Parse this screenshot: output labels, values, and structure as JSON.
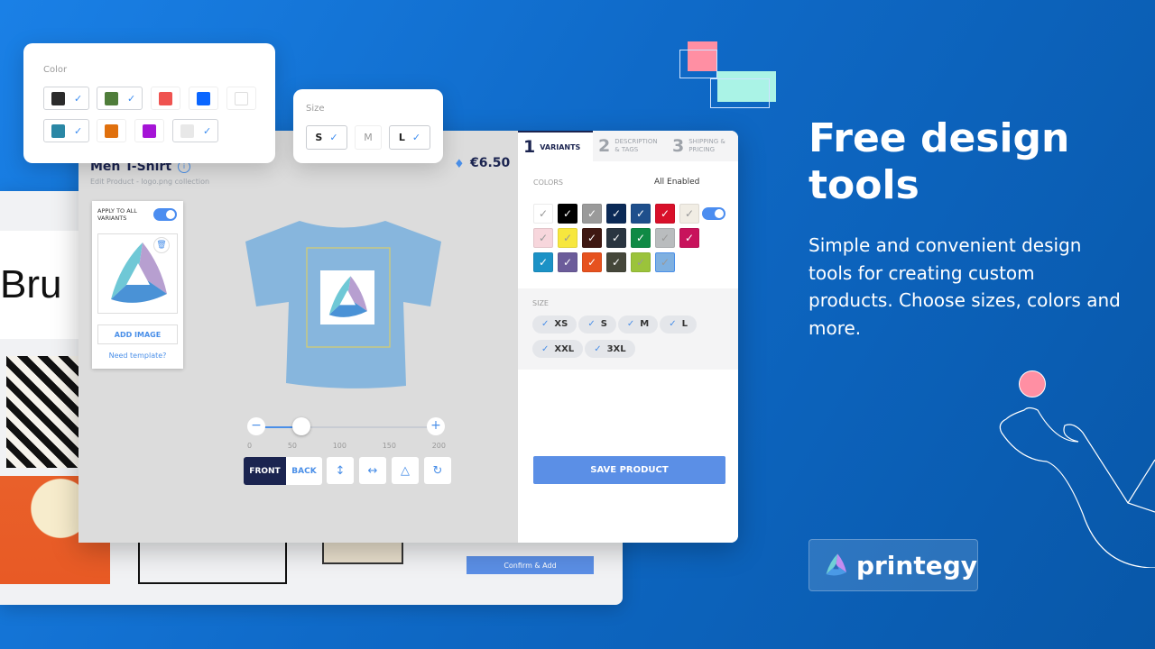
{
  "hero": {
    "title": "Free design tools",
    "description": "Simple and convenient design tools for creating custom products. Choose sizes, colors and more.",
    "brand": "printegy"
  },
  "background_panel": {
    "preview_text": "Bru",
    "confirm_label": "Confirm & Add"
  },
  "color_popup": {
    "label": "Color",
    "options": [
      {
        "color": "#2b2b2b",
        "checked": true
      },
      {
        "color": "#4f7d3a",
        "checked": true
      },
      {
        "color": "#ef5350",
        "checked": false
      },
      {
        "color": "#0a66ff",
        "checked": false
      },
      {
        "color": "#ffffff",
        "checked": false
      },
      {
        "color": "#2a87a5",
        "checked": true
      },
      {
        "color": "#e0700d",
        "checked": false
      },
      {
        "color": "#a514d6",
        "checked": false
      },
      {
        "color": "#e8e8e8",
        "checked": true
      }
    ]
  },
  "size_popup": {
    "label": "Size",
    "options": [
      {
        "label": "S",
        "checked": true
      },
      {
        "label": "M",
        "checked": false
      },
      {
        "label": "L",
        "checked": true
      }
    ]
  },
  "product": {
    "title": "Men T-Shirt",
    "subtitle": "Edit Product - logo.png collection",
    "price": "€6.50"
  },
  "image_panel": {
    "apply_label": "APPLY TO ALL VARIANTS",
    "apply_enabled": true,
    "add_image": "ADD IMAGE",
    "need_template": "Need template?"
  },
  "scale_slider": {
    "value": 50,
    "min": 0,
    "max": 200,
    "ticks": [
      "0",
      "50",
      "100",
      "150",
      "200"
    ]
  },
  "toolbar": {
    "front": "FRONT",
    "back": "BACK",
    "active": "FRONT"
  },
  "tabs": [
    {
      "num": "1",
      "label": "VARIANTS",
      "active": true
    },
    {
      "num": "2",
      "label": "DESCRIPTION & TAGS"
    },
    {
      "num": "3",
      "label": "SHIPPING & PRICING"
    }
  ],
  "colors": {
    "label": "COLORS",
    "all_enabled_label": "All Enabled",
    "all_enabled": true,
    "swatches": [
      "#ffffff",
      "#000000",
      "#9a9a9a",
      "#0b2a57",
      "#1e4f8c",
      "#d8102a",
      "#f1ede4",
      "#f7d6dc",
      "#f7e73e",
      "#3f1812",
      "#2a3540",
      "#0f8a45",
      "#b9bcbe",
      "#c8135c",
      "#1c92c6",
      "#6b5c9a",
      "#e6521f",
      "#45473a",
      "#9bc33b",
      "#7fb0e0"
    ],
    "selected": "#7fb0e0"
  },
  "sizes": {
    "label": "SIZE",
    "options": [
      "XS",
      "S",
      "M",
      "L",
      "XXL",
      "3XL"
    ]
  },
  "save_label": "SAVE PRODUCT"
}
